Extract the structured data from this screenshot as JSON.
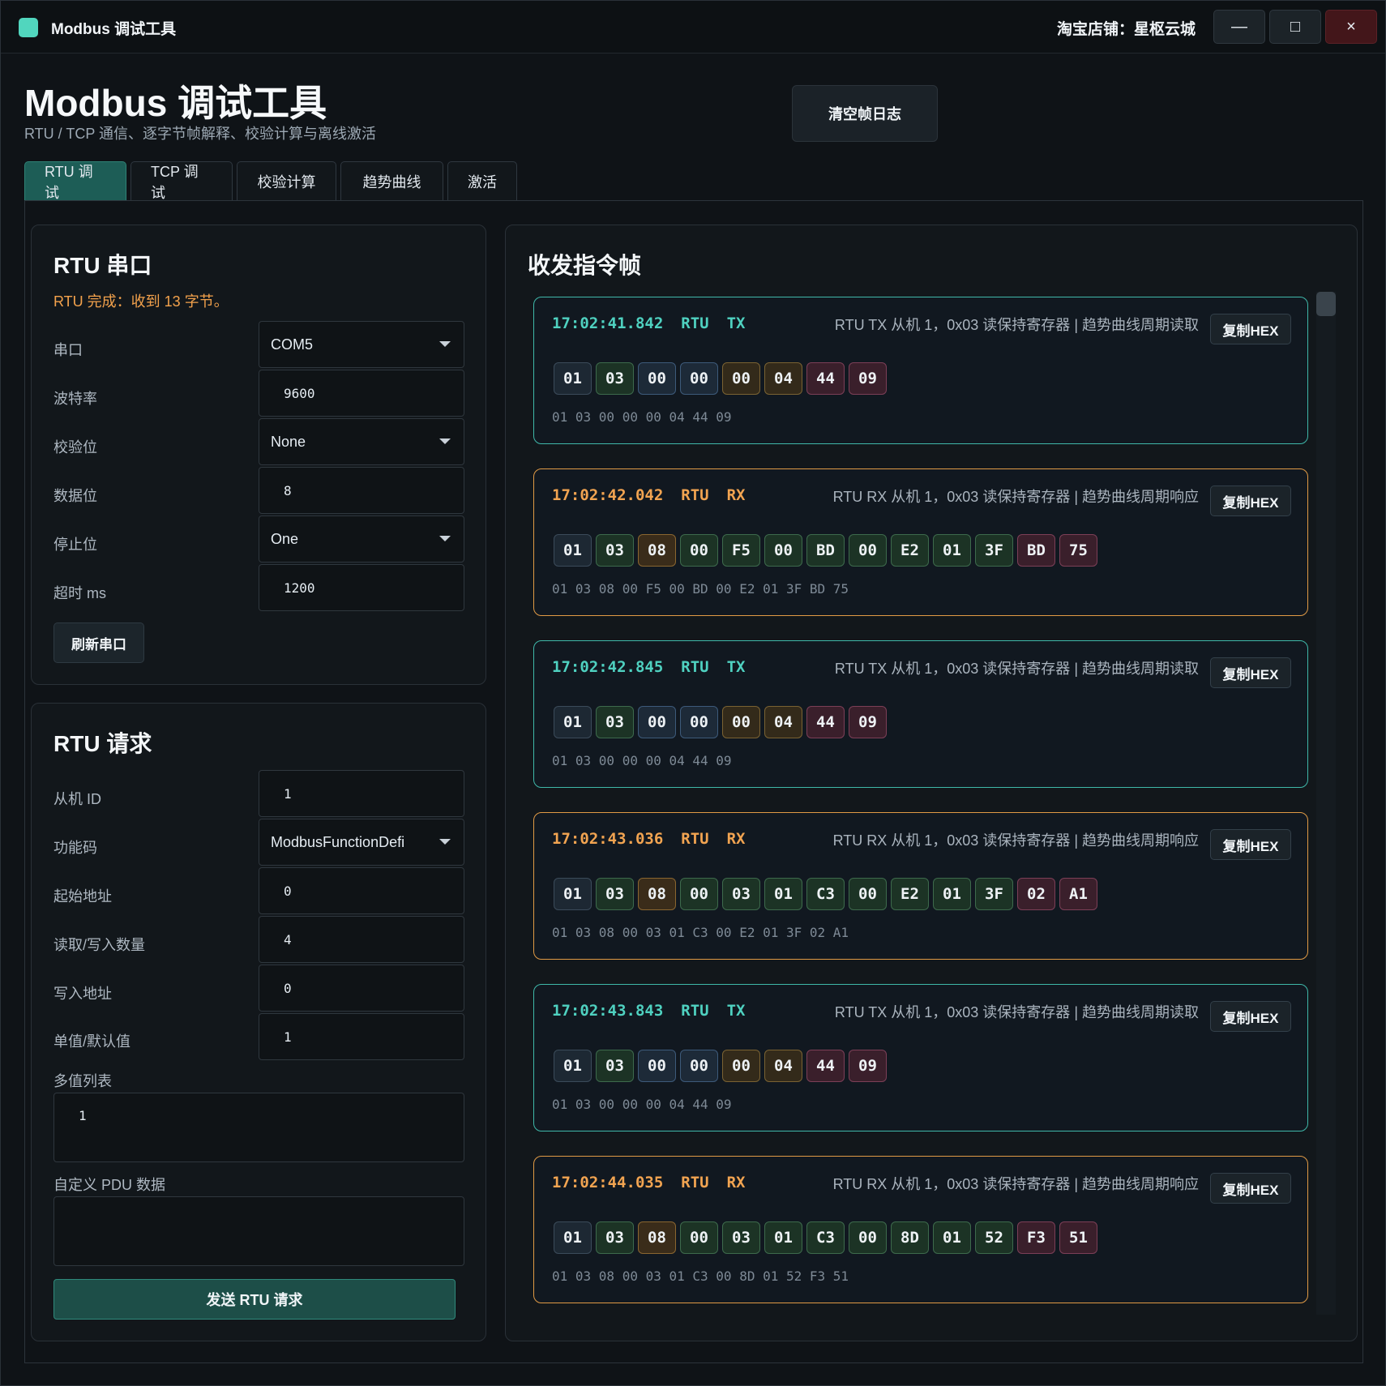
{
  "window": {
    "app_title": "Modbus 调试工具",
    "shop": "淘宝店铺：星枢云城",
    "minimize": "—",
    "maximize": "□",
    "close": "×"
  },
  "header": {
    "title": "Modbus 调试工具",
    "subtitle": "RTU / TCP 通信、逐字节帧解释、校验计算与离线激活",
    "clear_button": "清空帧日志"
  },
  "tabs": [
    {
      "label": "RTU 调试",
      "active": true
    },
    {
      "label": "TCP 调试",
      "active": false
    },
    {
      "label": "校验计算",
      "active": false
    },
    {
      "label": "趋势曲线",
      "active": false
    },
    {
      "label": "激活",
      "active": false
    }
  ],
  "serial": {
    "title": "RTU 串口",
    "status": "RTU 完成：收到 13 字节。",
    "port_label": "串口",
    "port_value": "COM5",
    "baud_label": "波特率",
    "baud_value": "9600",
    "parity_label": "校验位",
    "parity_value": "None",
    "databits_label": "数据位",
    "databits_value": "8",
    "stopbits_label": "停止位",
    "stopbits_value": "One",
    "timeout_label": "超时 ms",
    "timeout_value": "1200",
    "refresh_button": "刷新串口"
  },
  "request": {
    "title": "RTU 请求",
    "slave_label": "从机 ID",
    "slave_value": "1",
    "func_label": "功能码",
    "func_value": "ModbusFunctionDefi",
    "start_label": "起始地址",
    "start_value": "0",
    "count_label": "读取/写入数量",
    "count_value": "4",
    "write_label": "写入地址",
    "write_value": "0",
    "single_label": "单值/默认值",
    "single_value": "1",
    "multi_label": "多值列表",
    "multi_value": "1",
    "pdu_label": "自定义 PDU 数据",
    "pdu_value": "",
    "send_button": "发送 RTU 请求"
  },
  "frames_panel": {
    "title": "收发指令帧",
    "copy_label": "复制HEX",
    "frames": [
      {
        "time": "17:02:41.842",
        "proto": "RTU",
        "dir": "TX",
        "desc": "RTU TX 从机 1，0x03 读保持寄存器 | 趋势曲线周期读取",
        "bytes": [
          "01",
          "03",
          "00",
          "00",
          "00",
          "04",
          "44",
          "09"
        ],
        "kinds": [
          "addr",
          "fc",
          "reg",
          "reg",
          "cnt",
          "cnt",
          "crc",
          "crc"
        ],
        "hex": "01 03 00 00 00 04 44 09"
      },
      {
        "time": "17:02:42.042",
        "proto": "RTU",
        "dir": "RX",
        "desc": "RTU RX 从机 1，0x03 读保持寄存器 | 趋势曲线周期响应",
        "bytes": [
          "01",
          "03",
          "08",
          "00",
          "F5",
          "00",
          "BD",
          "00",
          "E2",
          "01",
          "3F",
          "BD",
          "75"
        ],
        "kinds": [
          "addr",
          "fc",
          "len",
          "data",
          "data",
          "data",
          "data",
          "data",
          "data",
          "data",
          "data",
          "crc",
          "crc"
        ],
        "hex": "01 03 08 00 F5 00 BD 00 E2 01 3F BD 75"
      },
      {
        "time": "17:02:42.845",
        "proto": "RTU",
        "dir": "TX",
        "desc": "RTU TX 从机 1，0x03 读保持寄存器 | 趋势曲线周期读取",
        "bytes": [
          "01",
          "03",
          "00",
          "00",
          "00",
          "04",
          "44",
          "09"
        ],
        "kinds": [
          "addr",
          "fc",
          "reg",
          "reg",
          "cnt",
          "cnt",
          "crc",
          "crc"
        ],
        "hex": "01 03 00 00 00 04 44 09"
      },
      {
        "time": "17:02:43.036",
        "proto": "RTU",
        "dir": "RX",
        "desc": "RTU RX 从机 1，0x03 读保持寄存器 | 趋势曲线周期响应",
        "bytes": [
          "01",
          "03",
          "08",
          "00",
          "03",
          "01",
          "C3",
          "00",
          "E2",
          "01",
          "3F",
          "02",
          "A1"
        ],
        "kinds": [
          "addr",
          "fc",
          "len",
          "data",
          "data",
          "data",
          "data",
          "data",
          "data",
          "data",
          "data",
          "crc",
          "crc"
        ],
        "hex": "01 03 08 00 03 01 C3 00 E2 01 3F 02 A1"
      },
      {
        "time": "17:02:43.843",
        "proto": "RTU",
        "dir": "TX",
        "desc": "RTU TX 从机 1，0x03 读保持寄存器 | 趋势曲线周期读取",
        "bytes": [
          "01",
          "03",
          "00",
          "00",
          "00",
          "04",
          "44",
          "09"
        ],
        "kinds": [
          "addr",
          "fc",
          "reg",
          "reg",
          "cnt",
          "cnt",
          "crc",
          "crc"
        ],
        "hex": "01 03 00 00 00 04 44 09"
      },
      {
        "time": "17:02:44.035",
        "proto": "RTU",
        "dir": "RX",
        "desc": "RTU RX 从机 1，0x03 读保持寄存器 | 趋势曲线周期响应",
        "bytes": [
          "01",
          "03",
          "08",
          "00",
          "03",
          "01",
          "C3",
          "00",
          "8D",
          "01",
          "52",
          "F3",
          "51"
        ],
        "kinds": [
          "addr",
          "fc",
          "len",
          "data",
          "data",
          "data",
          "data",
          "data",
          "data",
          "data",
          "data",
          "crc",
          "crc"
        ],
        "hex": "01 03 08 00 03 01 C3 00 8D 01 52 F3 51"
      }
    ]
  }
}
